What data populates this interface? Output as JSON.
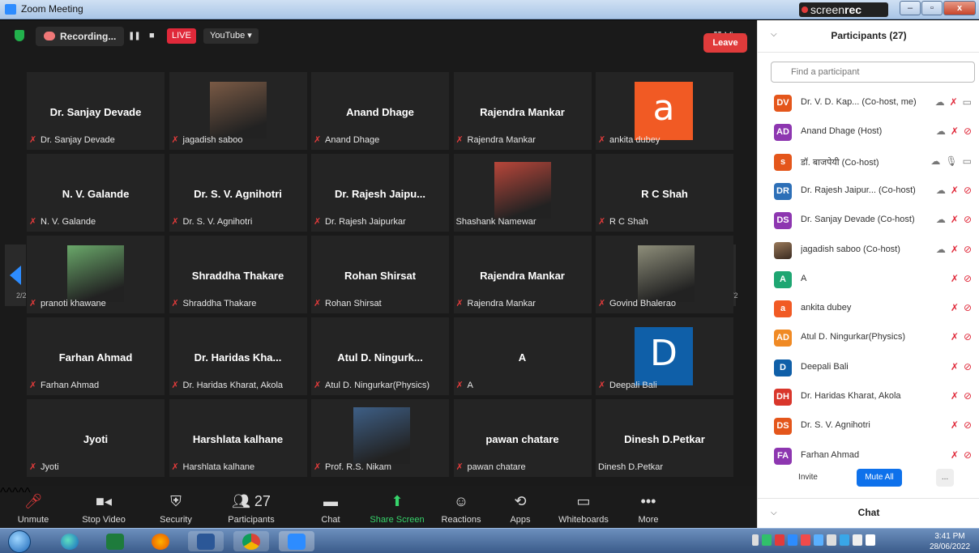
{
  "window": {
    "title": "Zoom Meeting",
    "controls": [
      "–",
      "▫",
      "x"
    ],
    "screenrec": {
      "prefix": "screen",
      "brand": "rec"
    }
  },
  "topbar": {
    "recording_label": "Recording...",
    "pause_glyph": "❚❚",
    "stop_glyph": "■",
    "live_label": "LIVE",
    "stream_label": "YouTube ▾",
    "view_label": "☷ View"
  },
  "tiles": [
    {
      "big": "Dr. Sanjay Devade",
      "name": "Dr. Sanjay Devade",
      "muted": true
    },
    {
      "big": "",
      "name": "jagadish saboo",
      "muted": true,
      "photo": true
    },
    {
      "big": "Anand Dhage",
      "name": "Anand Dhage",
      "muted": true
    },
    {
      "big": "Rajendra Mankar",
      "name": "Rajendra Mankar",
      "muted": true
    },
    {
      "big": "",
      "name": "ankita dubey",
      "muted": true,
      "avatar": "a",
      "avatar_color": "#f15a24"
    },
    {
      "big": "N. V. Galande",
      "name": "N. V. Galande",
      "muted": true
    },
    {
      "big": "Dr. S. V. Agnihotri",
      "name": "Dr. S. V. Agnihotri",
      "muted": true
    },
    {
      "big": "Dr. Rajesh Jaipu...",
      "name": "Dr. Rajesh Jaipurkar",
      "muted": true
    },
    {
      "big": "",
      "name": "Shashank Namewar",
      "muted": false,
      "photo": true
    },
    {
      "big": "R C Shah",
      "name": "R C Shah",
      "muted": true
    },
    {
      "big": "",
      "name": "pranoti khawane",
      "muted": true,
      "photo": true
    },
    {
      "big": "Shraddha Thakare",
      "name": "Shraddha Thakare",
      "muted": true
    },
    {
      "big": "Rohan Shirsat",
      "name": "Rohan Shirsat",
      "muted": true
    },
    {
      "big": "Rajendra  Mankar",
      "name": "Rajendra  Mankar",
      "muted": true
    },
    {
      "big": "",
      "name": "Govind Bhalerao",
      "muted": true,
      "photo": true
    },
    {
      "big": "Farhan Ahmad",
      "name": "Farhan Ahmad",
      "muted": true
    },
    {
      "big": "Dr. Haridas Kha...",
      "name": "Dr. Haridas Kharat, Akola",
      "muted": true
    },
    {
      "big": "Atul D. Ningurk...",
      "name": "Atul D. Ningurkar(Physics)",
      "muted": true
    },
    {
      "big": "A",
      "name": "A",
      "muted": true
    },
    {
      "big": "",
      "name": "Deepali Bali",
      "muted": true,
      "avatar": "D",
      "avatar_color": "#0f5fa8"
    },
    {
      "big": "Jyoti",
      "name": "Jyoti",
      "muted": true
    },
    {
      "big": "Harshlata kalhane",
      "name": "Harshlata kalhane",
      "muted": true
    },
    {
      "big": "",
      "name": "Prof. R.S. Nikam",
      "muted": true,
      "photo": true
    },
    {
      "big": "pawan chatare",
      "name": "pawan chatare",
      "muted": true
    },
    {
      "big": "Dinesh D.Petkar",
      "name": "Dinesh D.Petkar",
      "muted": false
    }
  ],
  "pager": {
    "left": "2/2",
    "right": "2/2"
  },
  "toolbar": [
    {
      "label": "Unmute",
      "icon": "🎤︎",
      "caret": true
    },
    {
      "label": "Stop Video",
      "icon": "■◂",
      "caret": true
    },
    {
      "label": "Security",
      "icon": "⛨"
    },
    {
      "label": "Participants",
      "icon": "👥︎ 27",
      "caret": true
    },
    {
      "label": "Chat",
      "icon": "▬",
      "caret": true
    },
    {
      "label": "Share Screen",
      "icon": "⬆",
      "caret": true,
      "green": true
    },
    {
      "label": "Reactions",
      "icon": "☺"
    },
    {
      "label": "Apps",
      "icon": "⟲"
    },
    {
      "label": "Whiteboards",
      "icon": "▭"
    },
    {
      "label": "More",
      "icon": "•••"
    }
  ],
  "leave_label": "Leave",
  "panel": {
    "title": "Participants (27)",
    "search_placeholder": "Find a participant",
    "participants": [
      {
        "initials": "DV",
        "color": "#e4561b",
        "name": "Dr. V. D. Kap... (Co-host, me)",
        "mic": "muted",
        "video": "off-gray"
      },
      {
        "initials": "AD",
        "color": "#8d36b0",
        "name": "Anand Dhage (Host)",
        "mic": "muted",
        "video": "off"
      },
      {
        "initials": "s",
        "color": "#e4561b",
        "name": "डॉ. बाजपेयी (Co-host)",
        "mic": "on",
        "video": "on"
      },
      {
        "initials": "DR",
        "color": "#2d6fb7",
        "name": "Dr. Rajesh Jaipur... (Co-host)",
        "mic": "muted",
        "video": "off"
      },
      {
        "initials": "DS",
        "color": "#8d36b0",
        "name": "Dr. Sanjay Devade (Co-host)",
        "mic": "muted",
        "video": "off"
      },
      {
        "initials": "",
        "color": "#6b4c3b",
        "name": "jagadish saboo (Co-host)",
        "mic": "muted",
        "video": "off",
        "photo": true
      },
      {
        "initials": "A",
        "color": "#1ea672",
        "name": "A",
        "mic": "muted",
        "video": "off"
      },
      {
        "initials": "a",
        "color": "#f15a24",
        "name": "ankita dubey",
        "mic": "muted",
        "video": "off"
      },
      {
        "initials": "AD",
        "color": "#f08a24",
        "name": "Atul D. Ningurkar(Physics)",
        "mic": "muted",
        "video": "off"
      },
      {
        "initials": "D",
        "color": "#0f5fa8",
        "name": "Deepali Bali",
        "mic": "muted",
        "video": "off"
      },
      {
        "initials": "DH",
        "color": "#d9362b",
        "name": "Dr. Haridas Kharat, Akola",
        "mic": "muted",
        "video": "off"
      },
      {
        "initials": "DS",
        "color": "#e4561b",
        "name": "Dr. S. V. Agnihotri",
        "mic": "muted",
        "video": "off"
      },
      {
        "initials": "FA",
        "color": "#8d36b0",
        "name": "Farhan Ahmad",
        "mic": "muted",
        "video": "off"
      }
    ],
    "invite_label": "Invite",
    "mute_all_label": "Mute All",
    "more_label": "...",
    "chat_label": "Chat"
  },
  "taskbar": {
    "time": "3:41 PM",
    "date": "28/06/2022"
  }
}
